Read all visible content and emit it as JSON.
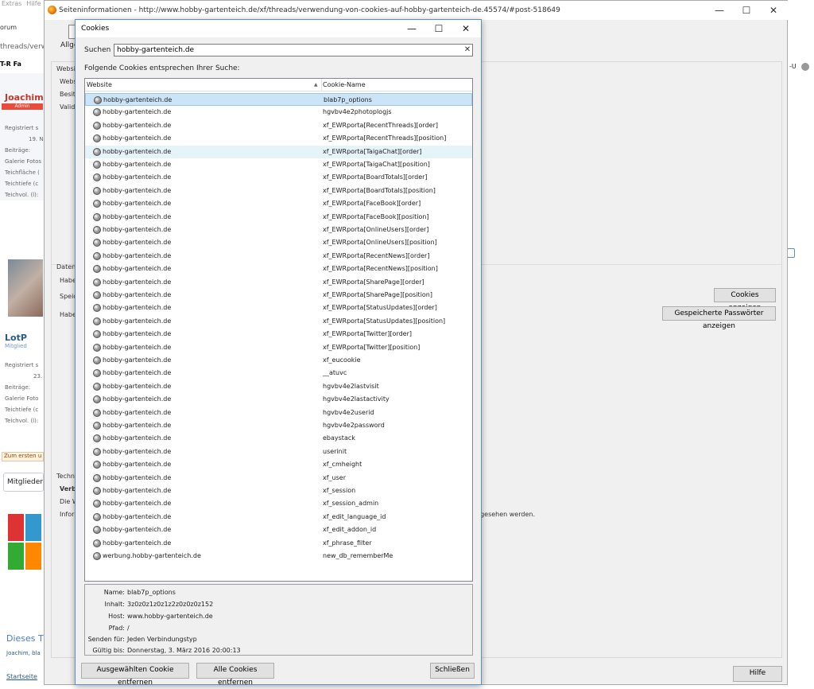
{
  "background": {
    "menu": [
      "Extras",
      "Hilfe"
    ],
    "forum_label": "orum",
    "url_fragment": "threads/verw",
    "toolbar": [
      "T-R",
      "Fa"
    ],
    "users": [
      {
        "name": "Joachim",
        "badge": "Admin",
        "stats": [
          "Registriert s",
          "19. N",
          "Beiträge:",
          "Galerie Fotos",
          "Teichfläche (",
          "Teichtiefe (c",
          "Teichvol. (l):"
        ]
      },
      {
        "name": "LotP",
        "role": "Mitglied",
        "stats": [
          "Registriert s",
          "23.",
          "Beiträge:",
          "Galerie Foto",
          "Teichtiefe (c",
          "Teichvol. (l):"
        ]
      }
    ],
    "zum_ersten": "Zum ersten u",
    "mitglieder": "Mitglieder",
    "dieses": "Dieses T",
    "joachim_bla": "Joachim, bla",
    "startseite": "Startseite",
    "right_labels": [
      "-U"
    ]
  },
  "page_info": {
    "title": "Seiteninformationen - http://www.hobby-gartenteich.de/xf/threads/verwendung-von-cookies-auf-hobby-gartenteich-de.45574/#post-518649",
    "tab_label": "Allge",
    "labels": [
      "Websit",
      "Webs",
      "Besitz",
      "Validi",
      "Datens",
      "Habe",
      "Speic",
      "Habe",
      "Techni",
      "Verbi",
      "Die W",
      "Inform"
    ],
    "buttons": {
      "cookies": "Cookies anzeigen",
      "passwords": "Gespeicherte Passwörter anzeigen",
      "hilfe": "Hilfe"
    },
    "tail_text": "ngesehen werden."
  },
  "dialog": {
    "title": "Cookies",
    "search_label": "Suchen",
    "search_value": "hobby-gartenteich.de",
    "match_label": "Folgende Cookies entsprechen Ihrer Suche:",
    "columns": [
      "Website",
      "Cookie-Name"
    ],
    "rows": [
      [
        "hobby-gartenteich.de",
        "blab7p_options"
      ],
      [
        "hobby-gartenteich.de",
        "hgvbv4e2photoplogjs"
      ],
      [
        "hobby-gartenteich.de",
        "xf_EWRporta[RecentThreads][order]"
      ],
      [
        "hobby-gartenteich.de",
        "xf_EWRporta[RecentThreads][position]"
      ],
      [
        "hobby-gartenteich.de",
        "xf_EWRporta[TaigaChat][order]"
      ],
      [
        "hobby-gartenteich.de",
        "xf_EWRporta[TaigaChat][position]"
      ],
      [
        "hobby-gartenteich.de",
        "xf_EWRporta[BoardTotals][order]"
      ],
      [
        "hobby-gartenteich.de",
        "xf_EWRporta[BoardTotals][position]"
      ],
      [
        "hobby-gartenteich.de",
        "xf_EWRporta[FaceBook][order]"
      ],
      [
        "hobby-gartenteich.de",
        "xf_EWRporta[FaceBook][position]"
      ],
      [
        "hobby-gartenteich.de",
        "xf_EWRporta[OnlineUsers][order]"
      ],
      [
        "hobby-gartenteich.de",
        "xf_EWRporta[OnlineUsers][position]"
      ],
      [
        "hobby-gartenteich.de",
        "xf_EWRporta[RecentNews][order]"
      ],
      [
        "hobby-gartenteich.de",
        "xf_EWRporta[RecentNews][position]"
      ],
      [
        "hobby-gartenteich.de",
        "xf_EWRporta[SharePage][order]"
      ],
      [
        "hobby-gartenteich.de",
        "xf_EWRporta[SharePage][position]"
      ],
      [
        "hobby-gartenteich.de",
        "xf_EWRporta[StatusUpdates][order]"
      ],
      [
        "hobby-gartenteich.de",
        "xf_EWRporta[StatusUpdates][position]"
      ],
      [
        "hobby-gartenteich.de",
        "xf_EWRporta[Twitter][order]"
      ],
      [
        "hobby-gartenteich.de",
        "xf_EWRporta[Twitter][position]"
      ],
      [
        "hobby-gartenteich.de",
        "xf_eucookie"
      ],
      [
        "hobby-gartenteich.de",
        "__atuvc"
      ],
      [
        "hobby-gartenteich.de",
        "hgvbv4e2lastvisit"
      ],
      [
        "hobby-gartenteich.de",
        "hgvbv4e2lastactivity"
      ],
      [
        "hobby-gartenteich.de",
        "hgvbv4e2userid"
      ],
      [
        "hobby-gartenteich.de",
        "hgvbv4e2password"
      ],
      [
        "hobby-gartenteich.de",
        "ebaystack"
      ],
      [
        "hobby-gartenteich.de",
        "userinit"
      ],
      [
        "hobby-gartenteich.de",
        "xf_cmheight"
      ],
      [
        "hobby-gartenteich.de",
        "xf_user"
      ],
      [
        "hobby-gartenteich.de",
        "xf_session"
      ],
      [
        "hobby-gartenteich.de",
        "xf_session_admin"
      ],
      [
        "hobby-gartenteich.de",
        "xf_edit_language_id"
      ],
      [
        "hobby-gartenteich.de",
        "xf_edit_addon_id"
      ],
      [
        "hobby-gartenteich.de",
        "xf_phrase_filter"
      ],
      [
        "werbung.hobby-gartenteich.de",
        "new_db_rememberMe"
      ]
    ],
    "details": {
      "name_label": "Name:",
      "name": "blab7p_options",
      "content_label": "Inhalt:",
      "content": "3z0z0z1z0z1z2z0z0z0z152",
      "host_label": "Host:",
      "host": "www.hobby-gartenteich.de",
      "path_label": "Pfad:",
      "path": "/",
      "send_label": "Senden für:",
      "send": "Jeden Verbindungstyp",
      "valid_label": "Gültig bis:",
      "valid": "Donnerstag, 3. März 2016 20:00:13"
    },
    "buttons": {
      "remove": "Ausgewählten Cookie entfernen",
      "remove_all": "Alle Cookies entfernen",
      "close": "Schließen"
    }
  }
}
